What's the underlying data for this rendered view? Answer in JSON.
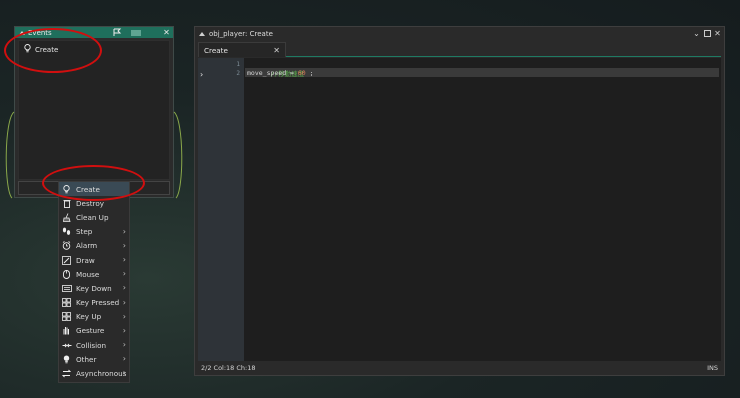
{
  "events_panel": {
    "title": "Events",
    "items": [
      {
        "label": "Create",
        "icon": "lightbulb-icon"
      }
    ]
  },
  "menu": {
    "items": [
      {
        "label": "Create",
        "icon": "lightbulb-icon",
        "has_submenu": false,
        "selected": true
      },
      {
        "label": "Destroy",
        "icon": "trash-icon",
        "has_submenu": false
      },
      {
        "label": "Clean Up",
        "icon": "broom-icon",
        "has_submenu": false
      },
      {
        "label": "Step",
        "icon": "footsteps-icon",
        "has_submenu": true
      },
      {
        "label": "Alarm",
        "icon": "alarm-clock-icon",
        "has_submenu": true
      },
      {
        "label": "Draw",
        "icon": "brush-icon",
        "has_submenu": true
      },
      {
        "label": "Mouse",
        "icon": "mouse-icon",
        "has_submenu": true
      },
      {
        "label": "Key Down",
        "icon": "keyboard-icon",
        "has_submenu": true
      },
      {
        "label": "Key Pressed",
        "icon": "keys-icon",
        "has_submenu": true
      },
      {
        "label": "Key Up",
        "icon": "keys-icon",
        "has_submenu": true
      },
      {
        "label": "Gesture",
        "icon": "hand-icon",
        "has_submenu": true
      },
      {
        "label": "Collision",
        "icon": "collision-icon",
        "has_submenu": true
      },
      {
        "label": "Other",
        "icon": "lightbulb-icon",
        "has_submenu": true
      },
      {
        "label": "Asynchronous",
        "icon": "swap-arrows-icon",
        "has_submenu": true
      }
    ]
  },
  "code_window": {
    "title": "obj_player: Create",
    "tab_label": "Create",
    "line_numbers": [
      "1",
      "2"
    ],
    "line1_comment": "//移動速度",
    "line2_ident": "move_speed",
    "line2_op": " = ",
    "line2_num": "60",
    "line2_end": " ;",
    "status_left": "2/2 Col:18 Ch:18",
    "status_right": "INS"
  },
  "colors": {
    "accent": "#1f6f5c",
    "annotation_red": "#d10f0f",
    "comment_green": "#57a64a",
    "number_orange": "#e07b5a"
  }
}
